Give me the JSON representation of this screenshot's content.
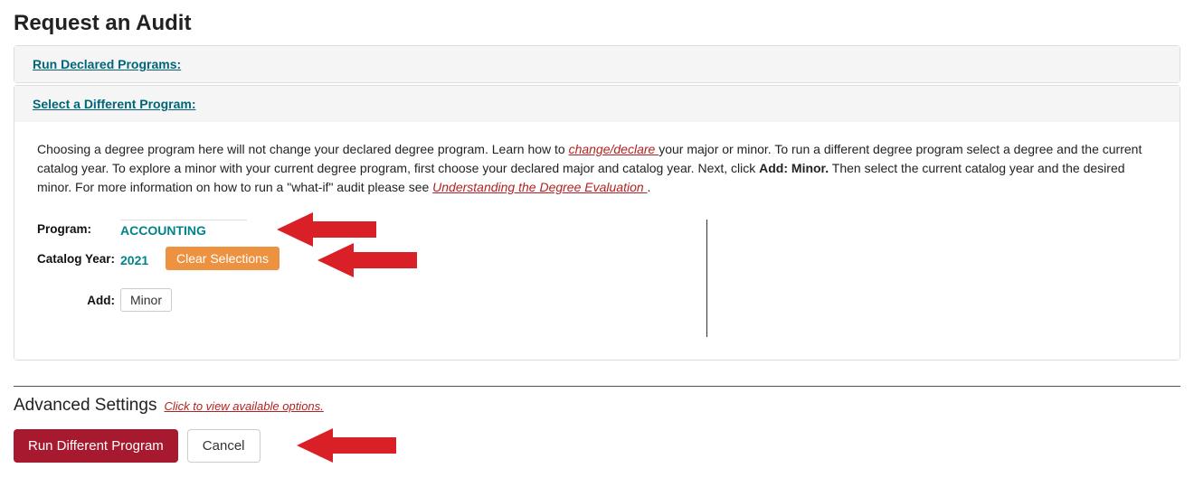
{
  "page_title": "Request an Audit",
  "panels": {
    "run_declared": "Run Declared Programs:",
    "select_diff": "Select a Different Program:"
  },
  "info": {
    "t1": "Choosing a degree program here will not change your declared degree program. Learn how to ",
    "link1": "change/declare ",
    "t2": "your major or minor. To run a different degree program select a degree and the current catalog year. To explore a minor with your current degree program, first choose your declared major and catalog year. Next, click ",
    "bold1": "Add: Minor.",
    "t3": " Then select the current catalog year and the desired minor. For more information on how to run a \"what-if\" audit please see ",
    "link2": "Understanding the Degree Evaluation ",
    "t4": "."
  },
  "form": {
    "program_label": "Program:",
    "program_value": "ACCOUNTING",
    "catalog_label": "Catalog Year:",
    "catalog_value": "2021",
    "clear_btn": "Clear Selections",
    "add_label": "Add:",
    "minor_btn": "Minor"
  },
  "advanced": {
    "title": "Advanced Settings",
    "link": "Click to view available options."
  },
  "actions": {
    "run": "Run Different Program",
    "cancel": "Cancel"
  }
}
